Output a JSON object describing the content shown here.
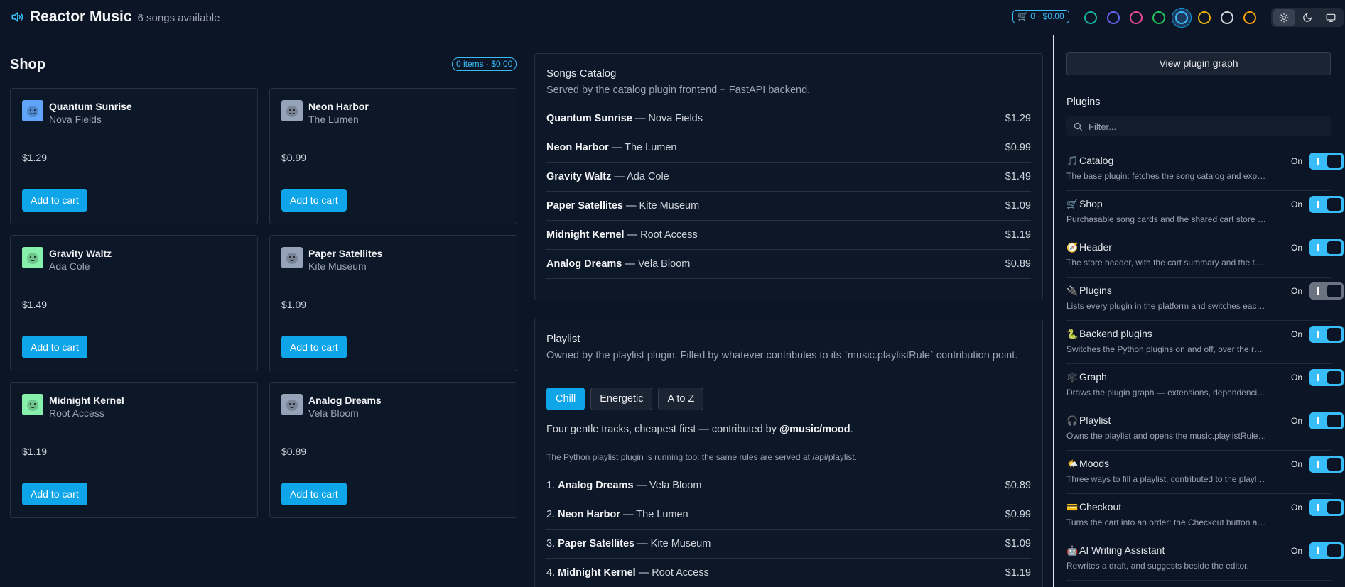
{
  "header": {
    "title": "Reactor Music",
    "subtitle": "6 songs available",
    "cart_summary": "🛒 0 · $0.00",
    "themes": [
      {
        "name": "teal",
        "color": "#14b8a6"
      },
      {
        "name": "indigo",
        "color": "#6366f1"
      },
      {
        "name": "pink",
        "color": "#ec4899"
      },
      {
        "name": "green",
        "color": "#22c55e"
      },
      {
        "name": "sky",
        "color": "#38bdf8",
        "active": true
      },
      {
        "name": "amber",
        "color": "#eab308"
      },
      {
        "name": "slate",
        "color": "#d1d5db"
      },
      {
        "name": "gold",
        "color": "#f59e0b"
      }
    ],
    "modes": [
      "light",
      "dark",
      "system"
    ]
  },
  "shop": {
    "title": "Shop",
    "badge": "0 items · $0.00",
    "add_label": "Add to cart",
    "cards": [
      {
        "title": "Quantum Sunrise",
        "artist": "Nova Fields",
        "price": "$1.29",
        "thumb": "#60a5fa"
      },
      {
        "title": "Neon Harbor",
        "artist": "The Lumen",
        "price": "$0.99",
        "thumb": "#94a3b8"
      },
      {
        "title": "Gravity Waltz",
        "artist": "Ada Cole",
        "price": "$1.49",
        "thumb": "#86efac"
      },
      {
        "title": "Paper Satellites",
        "artist": "Kite Museum",
        "price": "$1.09",
        "thumb": "#94a3b8"
      },
      {
        "title": "Midnight Kernel",
        "artist": "Root Access",
        "price": "$1.19",
        "thumb": "#86efac"
      },
      {
        "title": "Analog Dreams",
        "artist": "Vela Bloom",
        "price": "$0.89",
        "thumb": "#94a3b8"
      }
    ]
  },
  "catalog": {
    "title": "Songs Catalog",
    "subtitle": "Served by the catalog plugin frontend + FastAPI backend.",
    "rows": [
      {
        "title": "Quantum Sunrise",
        "artist": " — Nova Fields",
        "price": "$1.29"
      },
      {
        "title": "Neon Harbor",
        "artist": " — The Lumen",
        "price": "$0.99"
      },
      {
        "title": "Gravity Waltz",
        "artist": " — Ada Cole",
        "price": "$1.49"
      },
      {
        "title": "Paper Satellites",
        "artist": " — Kite Museum",
        "price": "$1.09"
      },
      {
        "title": "Midnight Kernel",
        "artist": " — Root Access",
        "price": "$1.19"
      },
      {
        "title": "Analog Dreams",
        "artist": " — Vela Bloom",
        "price": "$0.89"
      }
    ]
  },
  "playlist": {
    "title": "Playlist",
    "subtitle": "Owned by the playlist plugin. Filled by whatever contributes to its `music.playlistRule` contribution point.",
    "tabs": [
      "Chill",
      "Energetic",
      "A to Z"
    ],
    "active_tab": "Chill",
    "desc_prefix": "Four gentle tracks, cheapest first — contributed by ",
    "desc_source": "@music/mood",
    "desc_suffix": ".",
    "python_note": "The Python playlist plugin is running too: the same rules are served at /api/playlist.",
    "rows": [
      {
        "num": "1. ",
        "title": "Analog Dreams",
        "artist": " — Vela Bloom",
        "price": "$0.89"
      },
      {
        "num": "2. ",
        "title": "Neon Harbor",
        "artist": " — The Lumen",
        "price": "$0.99"
      },
      {
        "num": "3. ",
        "title": "Paper Satellites",
        "artist": " — Kite Museum",
        "price": "$1.09"
      },
      {
        "num": "4. ",
        "title": "Midnight Kernel",
        "artist": " — Root Access",
        "price": "$1.19"
      }
    ]
  },
  "sidebar": {
    "graph_button": "View plugin graph",
    "plugins_label": "Plugins",
    "filter_placeholder": "Filter...",
    "on_label": "On",
    "plugins": [
      {
        "emoji": "🎵",
        "name": "Catalog",
        "desc": "The base plugin: fetches the song catalog and exposes it to other plugins.",
        "on": true
      },
      {
        "emoji": "🛒",
        "name": "Shop",
        "desc": "Purchasable song cards and the shared cart store for the whole app.",
        "on": true
      },
      {
        "emoji": "🧭",
        "name": "Header",
        "desc": "The store header, with the cart summary and the theme pickers.",
        "on": true
      },
      {
        "emoji": "🔌",
        "name": "Plugins",
        "desc": "Lists every plugin in the platform and switches each one on or off.",
        "on": true,
        "locked": true
      },
      {
        "emoji": "🐍",
        "name": "Backend plugins",
        "desc": "Switches the Python plugins on and off, over the reactor API.",
        "on": true
      },
      {
        "emoji": "🕸️",
        "name": "Graph",
        "desc": "Draws the plugin graph — extensions, dependencies and contribution points.",
        "on": true
      },
      {
        "emoji": "🎧",
        "name": "Playlist",
        "desc": "Owns the playlist and opens the music.playlistRule contribution point.",
        "on": true
      },
      {
        "emoji": "🌤️",
        "name": "Moods",
        "desc": "Three ways to fill a playlist, contributed to the playlist rule point.",
        "on": true
      },
      {
        "emoji": "💳",
        "name": "Checkout",
        "desc": "Turns the cart into an order: the Checkout button and the order summary.",
        "on": true
      },
      {
        "emoji": "🤖",
        "name": "AI Writing Assistant",
        "desc": "Rewrites a draft, and suggests beside the editor.",
        "on": true
      }
    ]
  }
}
